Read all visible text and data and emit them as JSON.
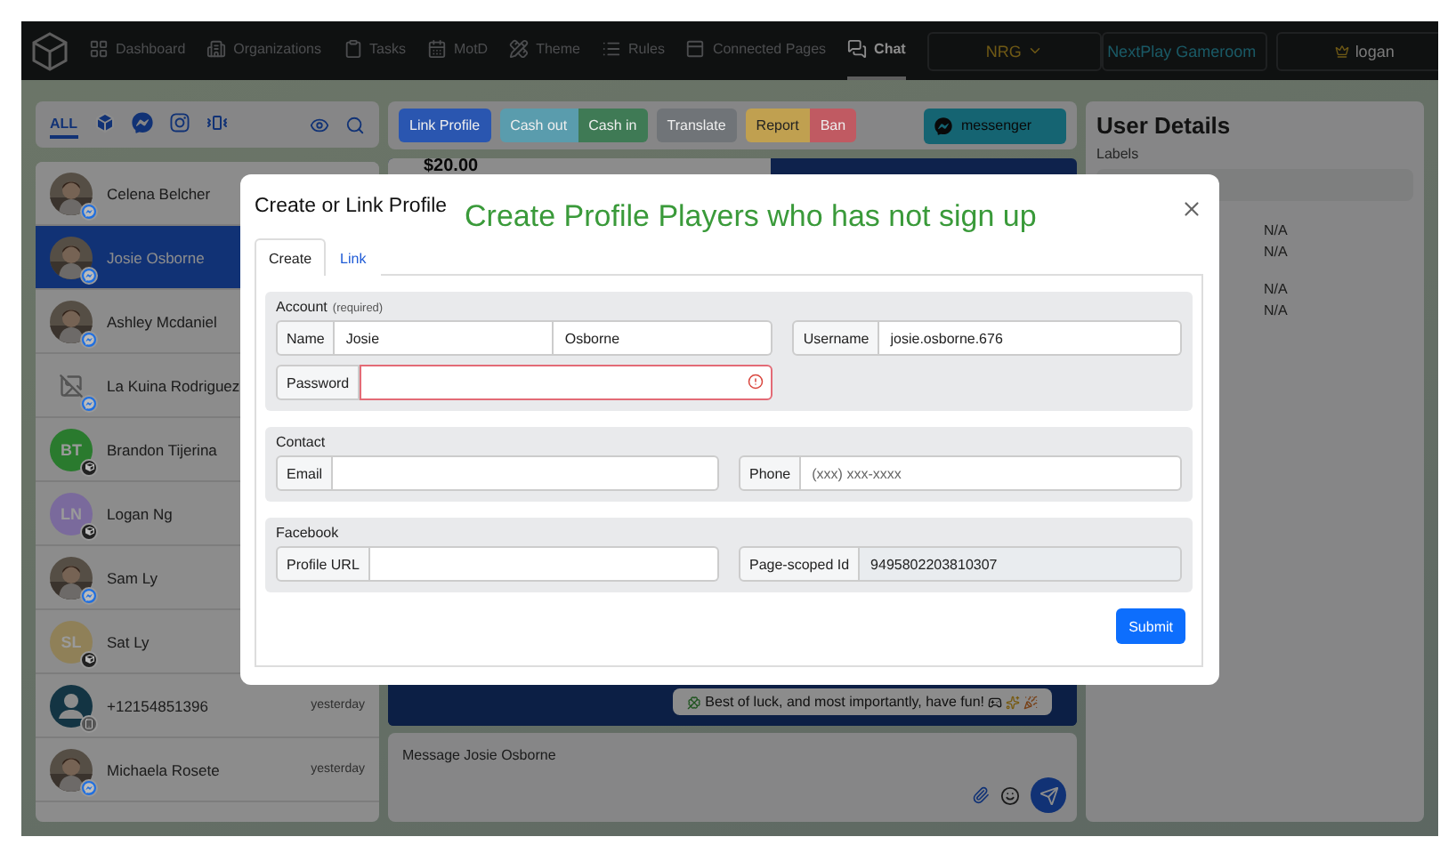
{
  "nav": {
    "items": [
      {
        "label": "Dashboard",
        "selected": false
      },
      {
        "label": "Organizations",
        "selected": false
      },
      {
        "label": "Tasks",
        "selected": false
      },
      {
        "label": "MotD",
        "selected": false
      },
      {
        "label": "Theme",
        "selected": false
      },
      {
        "label": "Rules",
        "selected": false
      },
      {
        "label": "Connected Pages",
        "selected": false
      },
      {
        "label": "Chat",
        "selected": true
      }
    ],
    "org": "NRG",
    "room": "NextPlay Gameroom",
    "user": "logan"
  },
  "sidebar": {
    "filters": [
      {
        "kind": "text",
        "label": "ALL",
        "selected": true
      },
      {
        "kind": "icon",
        "selected": false
      },
      {
        "kind": "icon",
        "selected": false
      },
      {
        "kind": "icon",
        "selected": false
      },
      {
        "kind": "icon",
        "selected": false
      }
    ],
    "contacts": [
      {
        "name": "Celena Belcher",
        "selected": false,
        "kind": "messenger"
      },
      {
        "name": "Josie Osborne",
        "selected": true,
        "kind": "messenger"
      },
      {
        "name": "Ashley Mcdaniel",
        "selected": false,
        "kind": "messenger"
      },
      {
        "name": "La Kuina Rodriguez",
        "selected": false,
        "avatar": {
          "kind": "broken"
        },
        "kind": "messenger"
      },
      {
        "name": "Brandon Tijerina",
        "selected": false,
        "avatar": {
          "kind": "initials",
          "initials": "BT",
          "color": "#2a7a2e"
        },
        "kind": "cube"
      },
      {
        "name": "Logan Ng",
        "selected": false,
        "avatar": {
          "kind": "initials",
          "initials": "LN",
          "color": "#7a6a9c"
        },
        "kind": "cube"
      },
      {
        "name": "Sam Ly",
        "selected": false,
        "kind": "messenger"
      },
      {
        "name": "Sat Ly",
        "selected": false,
        "avatar": {
          "kind": "initials",
          "initials": "SL",
          "color": "#8f8058"
        },
        "kind": "cube"
      },
      {
        "name": "+12154851396",
        "time": "yesterday",
        "selected": false,
        "avatar": {
          "kind": "person"
        },
        "kind": "phone"
      },
      {
        "name": "Michaela Rosete",
        "time": "yesterday",
        "selected": false,
        "kind": "messenger"
      }
    ]
  },
  "chat": {
    "actions": [
      {
        "label": "Link Profile",
        "color": "#2a56b0"
      },
      {
        "label": "Cash out",
        "color": "#5a9cad"
      },
      {
        "label": "Cash in",
        "color": "#3f7a55"
      },
      {
        "label": "Translate",
        "color": "#707478"
      },
      {
        "label": "Report",
        "color": "#c0a050"
      },
      {
        "label": "Ban",
        "color": "#c05a62"
      }
    ],
    "channel": "messenger",
    "amount": "$20.00",
    "bubble": "Best of luck, and most importantly, have fun!",
    "composer": {
      "placeholder": "Message Josie Osborne"
    }
  },
  "details": {
    "title": "User Details",
    "labels_heading": "Labels",
    "value_groups": [
      [
        "N/A",
        "N/A"
      ],
      [
        "N/A",
        "N/A"
      ]
    ]
  },
  "modal": {
    "title": "Create or Link Profile",
    "annotation": "Create Profile Players who has not sign up",
    "tabs": [
      {
        "label": "Create",
        "selected": true
      },
      {
        "label": "Link",
        "selected": false
      }
    ],
    "sections": [
      {
        "title": "Account",
        "note": "(required)",
        "fields": [
          {
            "label": "Name",
            "values": [
              "Josie",
              "Osborne"
            ],
            "invalid": false,
            "disabled": false
          },
          {
            "label": "Username",
            "values": [
              "josie.osborne.676"
            ],
            "invalid": false,
            "disabled": false
          },
          {
            "label": "Password",
            "invalid": true,
            "disabled": false
          }
        ]
      },
      {
        "title": "Contact",
        "fields": [
          {
            "label": "Email",
            "invalid": false,
            "disabled": false
          },
          {
            "label": "Phone",
            "placeholder": "(xxx) xxx-xxxx",
            "invalid": false,
            "disabled": false
          }
        ]
      },
      {
        "title": "Facebook",
        "fields": [
          {
            "label": "Profile URL",
            "invalid": false,
            "disabled": false
          },
          {
            "label": "Page-scoped Id",
            "values": [
              "9495802203810307"
            ],
            "invalid": false,
            "disabled": true
          }
        ]
      }
    ],
    "submit": "Submit"
  }
}
